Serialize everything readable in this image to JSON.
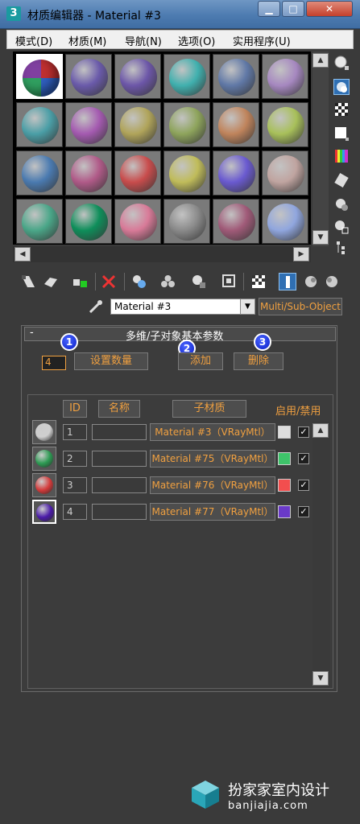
{
  "window": {
    "title": "材质编辑器 - Material #3",
    "logo_glyph": "3",
    "min_glyph": "▁",
    "max_glyph": "□",
    "close_glyph": "✕"
  },
  "menu": [
    "模式(D)",
    "材质(M)",
    "导航(N)",
    "选项(O)",
    "实用程序(U)"
  ],
  "slots": {
    "colors": [
      "#9a4a70",
      "#6a5aaa",
      "#6c56a8",
      "#40b0ae",
      "#6078a6",
      "#a688c0",
      "#4a9ea6",
      "#a45ab0",
      "#b0a45a",
      "#8ea45c",
      "#c0845c",
      "#a8c05a",
      "#4a7ab0",
      "#b05a88",
      "#c84c4c",
      "#c0bc5a",
      "#6a5ad0",
      "#c0a4a0",
      "#4aa688",
      "#0e8e5a",
      "#d87a98",
      "#8a8a8a",
      "#a05a78",
      "#90a6de"
    ]
  },
  "material_name": "Material #3",
  "material_type": "Multi/Sub-Object",
  "rollout": {
    "title": "多维/子对象基本参数",
    "collapse_glyph": "-",
    "count": "4",
    "set_count_label": "设置数量",
    "add_label": "添加",
    "delete_label": "删除",
    "callouts": [
      "1",
      "2",
      "3"
    ]
  },
  "table": {
    "headers": {
      "id": "ID",
      "name": "名称",
      "submaterial": "子材质",
      "enable": "启用/禁用"
    },
    "rows": [
      {
        "id": "1",
        "material": "Material #3（VRayMtl）",
        "color": "#dddddd",
        "ball": "#cfcfcf",
        "checked": "✓"
      },
      {
        "id": "2",
        "material": "Material #75（VRayMtl）",
        "color": "#3ec46a",
        "ball": "#2c9a52",
        "checked": "✓"
      },
      {
        "id": "3",
        "material": "Material #76（VRayMtl）",
        "color": "#f24e4e",
        "ball": "#d43a3a",
        "checked": "✓"
      },
      {
        "id": "4",
        "material": "Material #77（VRayMtl）",
        "color": "#6a3ac8",
        "ball": "#4a1aa8",
        "checked": "✓"
      }
    ]
  },
  "watermark": {
    "cn": "扮家家室内设计",
    "en": "banjiajia.com"
  }
}
